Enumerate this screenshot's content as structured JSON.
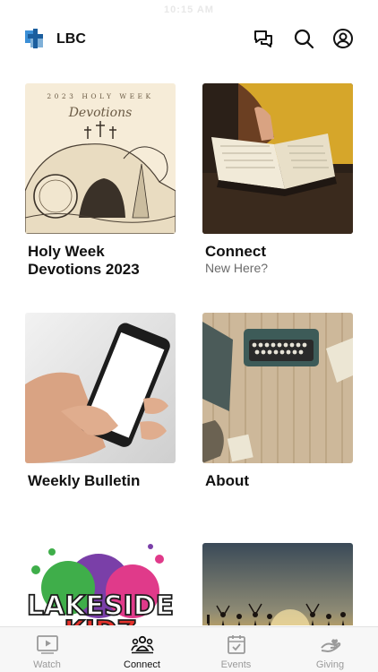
{
  "status": {
    "time": "10:15 AM"
  },
  "header": {
    "title": "LBC"
  },
  "cards": [
    {
      "title": "Holy Week Devotions 2023",
      "subtitle": "",
      "image": "holy-week-devotions-image",
      "image_text": [
        "2023 HOLY WEEK",
        "Devotions"
      ]
    },
    {
      "title": "Connect",
      "subtitle": "New Here?",
      "image": "bible-reading-image"
    },
    {
      "title": "Weekly Bulletin",
      "subtitle": "",
      "image": "phone-in-hand-image"
    },
    {
      "title": "About",
      "subtitle": "",
      "image": "typewriter-image"
    },
    {
      "title": "",
      "subtitle": "",
      "image": "lakeside-kidz-logo",
      "image_text": [
        "LAKESIDE",
        "KIDZ"
      ]
    },
    {
      "title": "",
      "subtitle": "",
      "image": "sunset-silhouettes-image"
    }
  ],
  "tabs": [
    {
      "label": "Watch",
      "icon": "play-icon",
      "active": false
    },
    {
      "label": "Connect",
      "icon": "people-icon",
      "active": true
    },
    {
      "label": "Events",
      "icon": "calendar-check-icon",
      "active": false
    },
    {
      "label": "Giving",
      "icon": "giving-hand-icon",
      "active": false
    }
  ],
  "colors": {
    "accent": "#111111",
    "inactive": "#9a9a9a",
    "tabbar_bg": "#f7f7f7"
  }
}
